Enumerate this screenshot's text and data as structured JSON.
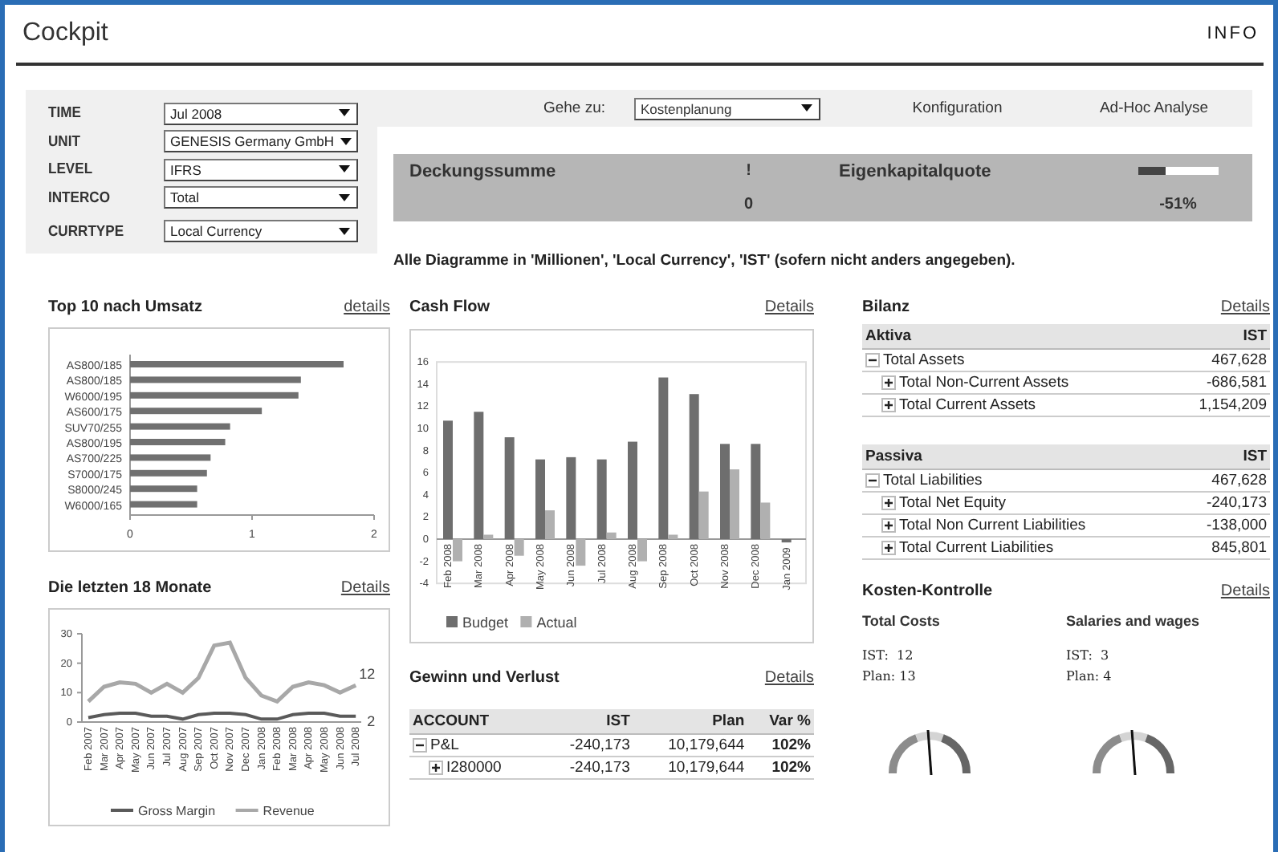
{
  "header": {
    "title": "Cockpit",
    "logo": "INFO"
  },
  "filters": [
    {
      "label": "TIME",
      "value": "Jul 2008"
    },
    {
      "label": "UNIT",
      "value": "GENESIS Germany GmbH"
    },
    {
      "label": "LEVEL",
      "value": "IFRS"
    },
    {
      "label": "INTERCO",
      "value": "Total"
    },
    {
      "label": "CURRTYPE",
      "value": "Local Currency"
    }
  ],
  "navigation": {
    "goto_label": "Gehe zu:",
    "goto_value": "Kostenplanung",
    "links": [
      "Konfiguration",
      "Ad-Hoc Analyse"
    ]
  },
  "kpis": [
    {
      "kind": "status",
      "title": "Deckungssumme",
      "indicator": "!",
      "value": "0"
    },
    {
      "kind": "meter",
      "title": "Eigenkapitalquote",
      "level": 0.35,
      "value": "-51%"
    }
  ],
  "note": "Alle Diagramme in 'Millionen', 'Local Currency', 'IST' (sofern nicht anders angegeben).",
  "top10": {
    "title": "Top 10 nach Umsatz",
    "details": "details",
    "chart_data": {
      "type": "bar",
      "orientation": "horizontal",
      "categories": [
        "AS800/185",
        "AS800/185",
        "W6000/195",
        "AS600/175",
        "SUV70/255",
        "AS800/195",
        "AS700/225",
        "S7000/175",
        "S8000/245",
        "W6000/165"
      ],
      "values": [
        1.75,
        1.4,
        1.38,
        1.08,
        0.82,
        0.78,
        0.66,
        0.63,
        0.55,
        0.55
      ],
      "xticks": [
        {
          "value": 0,
          "label": "0"
        },
        {
          "value": 1,
          "label": "1"
        },
        {
          "value": 2,
          "label": "2"
        }
      ],
      "xlim": [
        0,
        2
      ]
    }
  },
  "last_18_months": {
    "title": "Die letzten 18 Monate",
    "details": "Details",
    "chart_data": {
      "type": "line",
      "categories": [
        "Feb 2007",
        "Mar 2007",
        "Apr 2007",
        "May 2007",
        "Jun 2007",
        "Jul 2007",
        "Aug 2007",
        "Sep 2007",
        "Oct 2007",
        "Nov 2007",
        "Dec 2007",
        "Jan 2008",
        "Feb 2008",
        "Mar 2008",
        "Apr 2008",
        "May 2008",
        "Jun 2008",
        "Jul 2008"
      ],
      "series": [
        {
          "name": "Gross Margin",
          "color": "#5a5a5a",
          "values": [
            1.5,
            2.5,
            3,
            3,
            2,
            2,
            1,
            2.5,
            3,
            3,
            2.5,
            1,
            1,
            2.5,
            3,
            3,
            2,
            2
          ]
        },
        {
          "name": "Revenue",
          "color": "#a8a8a8",
          "values": [
            7,
            12,
            13.5,
            13,
            10,
            13,
            10,
            15,
            26,
            27,
            15,
            9,
            7,
            12,
            13.5,
            12.5,
            10,
            12.5
          ]
        }
      ],
      "yticks": [
        {
          "value": 0,
          "label": "0"
        },
        {
          "value": 10,
          "label": "10"
        },
        {
          "value": 20,
          "label": "20"
        },
        {
          "value": 30,
          "label": "30"
        }
      ],
      "ylim": [
        0,
        30
      ],
      "legend": "bottom",
      "annotations": [
        {
          "x": "Jul 2008",
          "y": 12.5,
          "text": "12"
        },
        {
          "x": "Jul 2008",
          "y": 2,
          "text": "2"
        }
      ]
    }
  },
  "cash_flow": {
    "title": "Cash Flow",
    "details": "Details",
    "chart_data": {
      "type": "bar",
      "categories": [
        "Feb 2008",
        "Mar 2008",
        "Apr 2008",
        "May 2008",
        "Jun 2008",
        "Jul 2008",
        "Aug 2008",
        "Sep 2008",
        "Oct 2008",
        "Nov 2008",
        "Dec 2008",
        "Jan 2009"
      ],
      "series": [
        {
          "name": "Budget",
          "color": "#6e6e6e",
          "values": [
            10.7,
            11.5,
            9.2,
            7.2,
            7.4,
            7.2,
            8.8,
            14.6,
            13.1,
            8.6,
            8.6,
            -0.3
          ]
        },
        {
          "name": "Actual",
          "color": "#b0b0b0",
          "values": [
            -2,
            0.4,
            -1.5,
            2.6,
            -2.4,
            0.6,
            -2,
            0.4,
            4.3,
            6.3,
            3.3,
            null
          ]
        }
      ],
      "yticks": [
        {
          "value": -4,
          "label": "-4"
        },
        {
          "value": -2,
          "label": "-2"
        },
        {
          "value": 0,
          "label": "0"
        },
        {
          "value": 2,
          "label": "2"
        },
        {
          "value": 4,
          "label": "4"
        },
        {
          "value": 6,
          "label": "6"
        },
        {
          "value": 8,
          "label": "8"
        },
        {
          "value": 10,
          "label": "10"
        },
        {
          "value": 12,
          "label": "12"
        },
        {
          "value": 14,
          "label": "14"
        },
        {
          "value": 16,
          "label": "16"
        }
      ],
      "ylim": [
        -4,
        16
      ],
      "legend": "bottom"
    }
  },
  "profit_loss": {
    "title": "Gewinn und Verlust",
    "details": "Details",
    "columns": [
      "ACCOUNT",
      "IST",
      "Plan",
      "Var %"
    ],
    "rows": [
      {
        "cells": [
          "P&L",
          "-240,173",
          "10,179,644",
          "102%"
        ],
        "expanded": true,
        "children": [
          {
            "cells": [
              "I280000",
              "-240,173",
              "10,179,644",
              "102%"
            ],
            "expanded": false
          }
        ]
      }
    ]
  },
  "balance": {
    "title": "Bilanz",
    "details": "Details",
    "sections": [
      {
        "header": "Aktiva",
        "column": "IST",
        "rows": [
          {
            "label": "Total Assets",
            "value": "467,628",
            "expanded": true,
            "children": [
              {
                "label": "Total Non-Current Assets",
                "value": "-686,581",
                "expanded": false
              },
              {
                "label": "Total Current Assets",
                "value": "1,154,209",
                "expanded": false
              }
            ]
          }
        ]
      },
      {
        "header": "Passiva",
        "column": "IST",
        "rows": [
          {
            "label": "Total Liabilities",
            "value": "467,628",
            "expanded": true,
            "children": [
              {
                "label": "Total Net Equity",
                "value": "-240,173",
                "expanded": false
              },
              {
                "label": "Total Non Current Liabilities",
                "value": "-138,000",
                "expanded": false
              },
              {
                "label": "Total Current Liabilities",
                "value": "845,801",
                "expanded": false
              }
            ]
          }
        ]
      }
    ]
  },
  "cost_control": {
    "title": "Kosten-Kontrolle",
    "details": "Details",
    "items": [
      {
        "name": "Total Costs",
        "ist": "IST:  12",
        "plan": "Plan: 13"
      },
      {
        "name": "Salaries and wages",
        "ist": "IST:  3",
        "plan": "Plan: 4"
      }
    ]
  }
}
